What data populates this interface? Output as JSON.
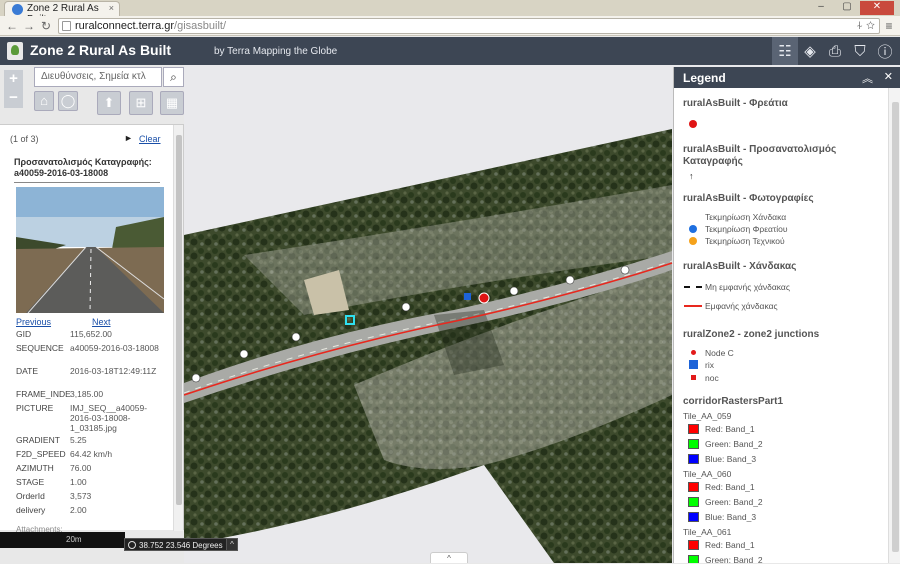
{
  "browser": {
    "tab_title": "Zone 2 Rural As Built",
    "tab_close": "×",
    "url_host": "ruralconnect.terra.gr",
    "url_path": "/gisasbuilt/",
    "url_right_icons": "⍭ ☆",
    "back": "←",
    "forward": "→",
    "reload": "↻",
    "menu": "≡",
    "window_controls": [
      "–",
      "▢",
      "✕"
    ]
  },
  "header": {
    "title": "Zone 2 Rural As Built",
    "subtitle": "by Terra Mapping the Globe",
    "buttons": [
      {
        "name": "legend-list-button",
        "icon": "☷"
      },
      {
        "name": "layers-button",
        "icon": "◈"
      },
      {
        "name": "print-button",
        "icon": "⎙"
      },
      {
        "name": "filter-button",
        "icon": "⛉"
      },
      {
        "name": "info-button",
        "icon": "ⓘ"
      }
    ]
  },
  "map_controls": {
    "zoom_in": "+",
    "zoom_out": "−",
    "search_placeholder": "Διευθύνσεις, Σημεία κτλ",
    "search_icon": "⌕",
    "home_icon": "⌂",
    "locate_icon": "◯",
    "tool_icons": [
      "⬆",
      "⊞",
      "▦"
    ]
  },
  "popup": {
    "count": "(1 of 3)",
    "next_arrow": "►",
    "clear": "Clear",
    "title": "Προσανατολισμός Καταγραφής: a40059-2016-03-18008",
    "previous": "Previous",
    "next": "Next",
    "attributes": [
      {
        "key": "GID",
        "value": "115,652.00"
      },
      {
        "key": "SEQUENCE",
        "value": "a40059-2016-03-18008"
      },
      {
        "key": "DATE",
        "value": "2016-03-18T12:49:11Z"
      },
      {
        "key": "FRAME_INDE",
        "value": "3,185.00"
      },
      {
        "key": "PICTURE",
        "value": "IMJ_SEQ__a40059-2016-03-18008-1_03185.jpg"
      },
      {
        "key": "GRADIENT",
        "value": "5.25"
      },
      {
        "key": "F2D_SPEED",
        "value": "64.42 km/h"
      },
      {
        "key": "AZIMUTH",
        "value": "76.00"
      },
      {
        "key": "STAGE",
        "value": "1.00"
      },
      {
        "key": "OrderId",
        "value": "3,573"
      },
      {
        "key": "delivery",
        "value": "2.00"
      }
    ],
    "attachments": "Attachments:"
  },
  "status": {
    "scale": "20m",
    "coordinates": "38.752 23.546 Degrees",
    "caret": "^",
    "bottom_toggle": "^"
  },
  "legend": {
    "title": "Legend",
    "collapse": "︽",
    "close": "✕",
    "layers": [
      {
        "title": "ruralAsBuilt - Φρεάτια"
      },
      {
        "title": "ruralAsBuilt - Προσανατολισμός Καταγραφής"
      },
      {
        "title": "ruralAsBuilt - Φωτογραφίες"
      },
      {
        "title": "ruralAsBuilt - Χάνδακας"
      },
      {
        "title": "ruralZone2 - zone2 junctions"
      },
      {
        "title": "corridorRastersPart1"
      }
    ],
    "photo_items": [
      {
        "label": "Τεκμηρίωση Χάνδακα",
        "color": ""
      },
      {
        "label": "Τεκμηρίωση Φρεατίου",
        "color": "#1e6fe0"
      },
      {
        "label": "Τεκμηρίωση Τεχνικού",
        "color": "#f5a21b"
      }
    ],
    "trench_items": [
      {
        "label": "Μη εμφανής χάνδακας"
      },
      {
        "label": "Εμφανής χάνδακας"
      }
    ],
    "junction_items": [
      {
        "label": "Node C",
        "color": "#e21b1b"
      },
      {
        "label": "rix",
        "color": "#1d63d8"
      },
      {
        "label": "noc",
        "color": "#e21b1b"
      }
    ],
    "tiles": [
      {
        "name": "Tile_AA_059",
        "bands": [
          {
            "label": "Red: Band_1",
            "color": "#ff0000"
          },
          {
            "label": "Green: Band_2",
            "color": "#00ff00"
          },
          {
            "label": "Blue: Band_3",
            "color": "#0000ff"
          }
        ]
      },
      {
        "name": "Tile_AA_060",
        "bands": [
          {
            "label": "Red: Band_1",
            "color": "#ff0000"
          },
          {
            "label": "Green: Band_2",
            "color": "#00ff00"
          },
          {
            "label": "Blue: Band_3",
            "color": "#0000ff"
          }
        ]
      },
      {
        "name": "Tile_AA_061",
        "bands": [
          {
            "label": "Red: Band_1",
            "color": "#ff0000"
          },
          {
            "label": "Green: Band_2",
            "color": "#00ff00"
          }
        ]
      }
    ]
  },
  "colors": {
    "header_bg": "#3d4654",
    "trench_red": "#e8281e",
    "manhole_red": "#e01414",
    "link_blue": "#1a4fa8"
  }
}
